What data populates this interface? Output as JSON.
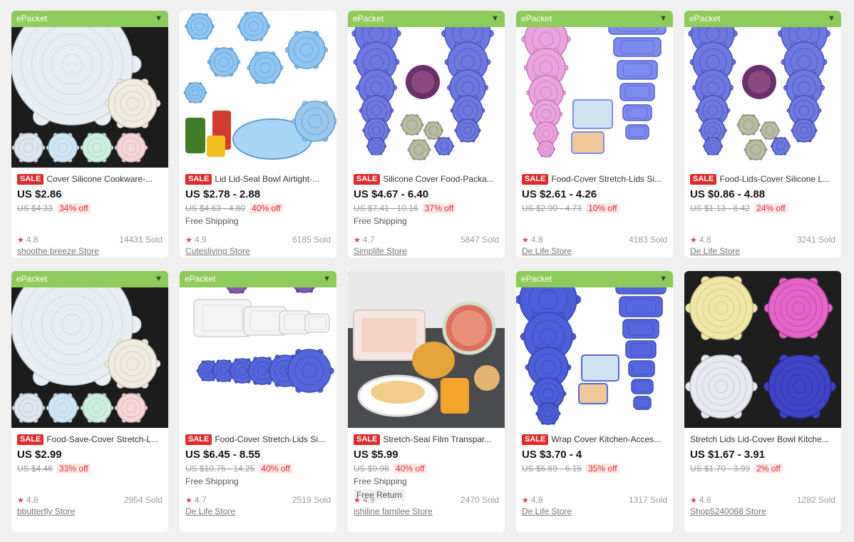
{
  "colors": {
    "epacket_green": "#8dcb5a",
    "sale_red": "#e02a2a",
    "star_red": "#d9404a"
  },
  "epacket_icon": "chevron-down-icon",
  "products": [
    {
      "epacket": "ePacket",
      "sale": "SALE",
      "title": "Cover Silicone Cookware-...",
      "price": "US $2.86",
      "orig": "US $4.33",
      "off": "34% off",
      "shipping": "",
      "free_return": "",
      "rating": "4.8",
      "sold": "14431 Sold",
      "store": "shoothe breeze Store",
      "image": "clear-lids-dark"
    },
    {
      "epacket": "",
      "sale": "SALE",
      "title": "Lid Lid-Seal Bowl Airtight-...",
      "price": "US $2.78 - 2.88",
      "orig": "US $4.63 - 4.80",
      "off": "40% off",
      "shipping": "Free Shipping",
      "free_return": "",
      "rating": "4.9",
      "sold": "6185 Sold",
      "store": "Cutesliving Store",
      "image": "blue-lids-scattered"
    },
    {
      "epacket": "ePacket",
      "sale": "SALE",
      "title": "Silicone Cover Food-Packa...",
      "price": "US $4.67 - 6.40",
      "orig": "US $7.41 - 10.16",
      "off": "37% off",
      "shipping": "Free Shipping",
      "free_return": "",
      "rating": "4.7",
      "sold": "5847 Sold",
      "store": "Simplife Store",
      "image": "blue-stacks"
    },
    {
      "epacket": "ePacket",
      "sale": "SALE",
      "title": "Food-Cover Stretch-Lids Si...",
      "price": "US $2.61 - 4.26",
      "orig": "US $2.90 - 4.73",
      "off": "10% off",
      "shipping": "",
      "free_return": "",
      "rating": "4.8",
      "sold": "4183 Sold",
      "store": "De Life Store",
      "image": "pink-blue-rect"
    },
    {
      "epacket": "ePacket",
      "sale": "SALE",
      "title": "Food-Lids-Cover Silicone L...",
      "price": "US $0.86 - 4.88",
      "orig": "US $1.13 - 6.42",
      "off": "24% off",
      "shipping": "",
      "free_return": "",
      "rating": "4.8",
      "sold": "3241 Sold",
      "store": "De Life Store",
      "image": "blue-stacks"
    },
    {
      "epacket": "ePacket",
      "sale": "SALE",
      "title": "Food-Save-Cover Stretch-L...",
      "price": "US $2.99",
      "orig": "US $4.46",
      "off": "33% off",
      "shipping": "",
      "free_return": "",
      "rating": "4.8",
      "sold": "2954 Sold",
      "store": "bbutterfly Store",
      "image": "clear-lids-dark"
    },
    {
      "epacket": "ePacket",
      "sale": "SALE",
      "title": "Food-Cover Stretch-Lids Si...",
      "price": "US $6.45 - 8.55",
      "orig": "US $10.75 - 14.25",
      "off": "40% off",
      "shipping": "Free Shipping",
      "free_return": "",
      "rating": "4.7",
      "sold": "2519 Sold",
      "store": "De Life Store",
      "image": "white-rect-blue-round"
    },
    {
      "epacket": "",
      "sale": "SALE",
      "title": "Stretch-Seal Film Transpar...",
      "price": "US $5.99",
      "orig": "US $9.98",
      "off": "40% off",
      "shipping": "Free Shipping",
      "free_return": "Free Return",
      "rating": "4.9",
      "sold": "2470 Sold",
      "store": "ishiline familee Store",
      "image": "food-bowls"
    },
    {
      "epacket": "ePacket",
      "sale": "SALE",
      "title": "Wrap Cover Kitchen-Acces...",
      "price": "US $3.70 - 4",
      "orig": "US $5.69 - 6.15",
      "off": "35% off",
      "shipping": "",
      "free_return": "",
      "rating": "4.8",
      "sold": "1317 Sold",
      "store": "De Life Store",
      "image": "blue-round-rect"
    },
    {
      "epacket": "",
      "sale": "",
      "title": "Stretch Lids Lid-Cover Bowl Kitche...",
      "price": "US $1.67 - 3.91",
      "orig": "US $1.70 - 3.99",
      "off": "2% off",
      "shipping": "",
      "free_return": "",
      "rating": "4.8",
      "sold": "1282 Sold",
      "store": "Shop5240068 Store",
      "image": "colorful-lids-dark"
    }
  ]
}
